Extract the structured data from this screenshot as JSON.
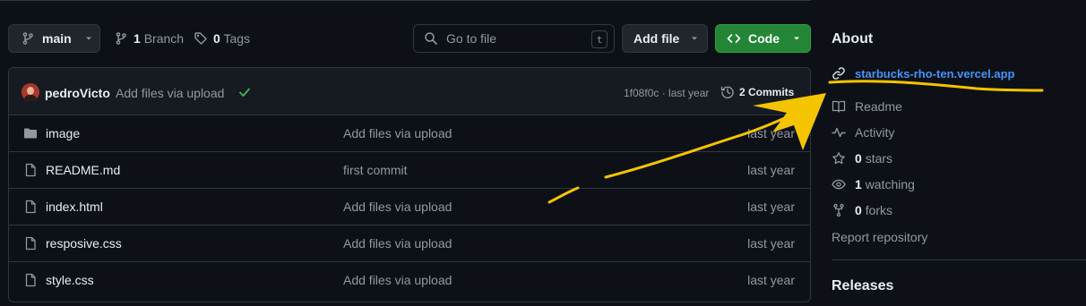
{
  "toolbar": {
    "branch_name": "main",
    "branches_count": "1",
    "branches_label": "Branch",
    "tags_count": "0",
    "tags_label": "Tags",
    "search_placeholder": "Go to file",
    "search_shortcut": "t",
    "add_file_label": "Add file",
    "code_label": "Code"
  },
  "commit": {
    "author": "pedroVicto",
    "message": "Add files via upload",
    "hash_time": "1f08f0c · last year",
    "commits_label": "2 Commits"
  },
  "files": [
    {
      "name": "image",
      "type": "folder",
      "message": "Add files via upload",
      "date": "last year"
    },
    {
      "name": "README.md",
      "type": "file",
      "message": "first commit",
      "date": "last year"
    },
    {
      "name": "index.html",
      "type": "file",
      "message": "Add files via upload",
      "date": "last year"
    },
    {
      "name": "resposive.css",
      "type": "file",
      "message": "Add files via upload",
      "date": "last year"
    },
    {
      "name": "style.css",
      "type": "file",
      "message": "Add files via upload",
      "date": "last year"
    }
  ],
  "about": {
    "heading": "About",
    "website": "starbucks-rho-ten.vercel.app",
    "readme": "Readme",
    "activity": "Activity",
    "stars_count": "0",
    "stars_label": "stars",
    "watching_count": "1",
    "watching_label": "watching",
    "forks_count": "0",
    "forks_label": "forks",
    "report": "Report repository"
  },
  "releases": {
    "heading": "Releases"
  },
  "colors": {
    "background": "#0d1117",
    "link": "#4493f8",
    "code_button": "#238636",
    "success_check": "#3fb950",
    "annotation": "#f5c400"
  }
}
